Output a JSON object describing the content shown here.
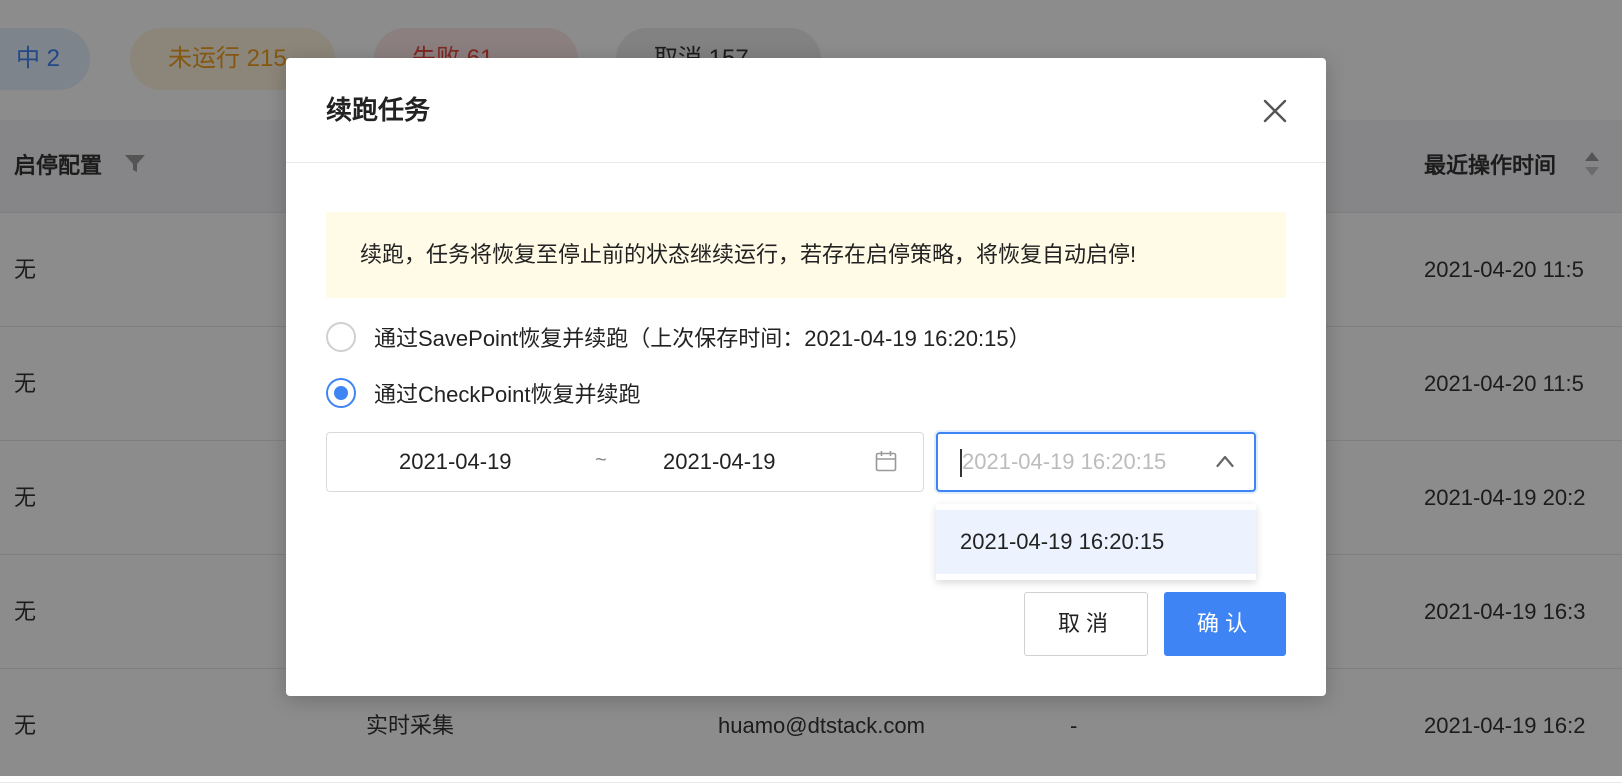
{
  "status_tabs": [
    {
      "label": "中 2"
    },
    {
      "label": "未运行 215"
    },
    {
      "label": "失败 61"
    },
    {
      "label": "取消 157"
    }
  ],
  "table": {
    "columns": [
      {
        "label": "启停配置",
        "icon": "filter-icon"
      },
      {
        "label": "最近操作时间",
        "icon": "sort-icon"
      }
    ],
    "rows": [
      {
        "config": "无",
        "type": "",
        "owner": "",
        "extra": "",
        "time": "2021-04-20 11:5"
      },
      {
        "config": "无",
        "type": "",
        "owner": "",
        "extra": "",
        "time": "2021-04-20 11:5"
      },
      {
        "config": "无",
        "type": "",
        "owner": "",
        "extra": "",
        "time": "2021-04-19 20:2"
      },
      {
        "config": "无",
        "type": "",
        "owner": "",
        "extra": "",
        "time": "2021-04-19 16:3"
      },
      {
        "config": "无",
        "type": "实时采集",
        "owner": "huamo@dtstack.com",
        "extra": "-",
        "time": "2021-04-19 16:2"
      }
    ]
  },
  "modal": {
    "title": "续跑任务",
    "alert": "续跑，任务将恢复至停止前的状态继续运行，若存在启停策略，将恢复自动启停!",
    "options": [
      {
        "label": "通过SavePoint恢复并续跑（上次保存时间：2021-04-19 16:20:15）",
        "checked": false
      },
      {
        "label": "通过CheckPoint恢复并续跑",
        "checked": true
      }
    ],
    "date_range": {
      "start": "2021-04-19",
      "separator": "~",
      "end": "2021-04-19"
    },
    "time_select": {
      "placeholder": "2021-04-19 16:20:15",
      "open": true
    },
    "dropdown_options": [
      "2021-04-19 16:20:15"
    ],
    "cancel_label": "取消",
    "confirm_label": "确认"
  },
  "colors": {
    "primary": "#3f84f5",
    "alert_bg": "#fffbe6",
    "warning": "#f0a020",
    "danger": "#e84a3c"
  }
}
